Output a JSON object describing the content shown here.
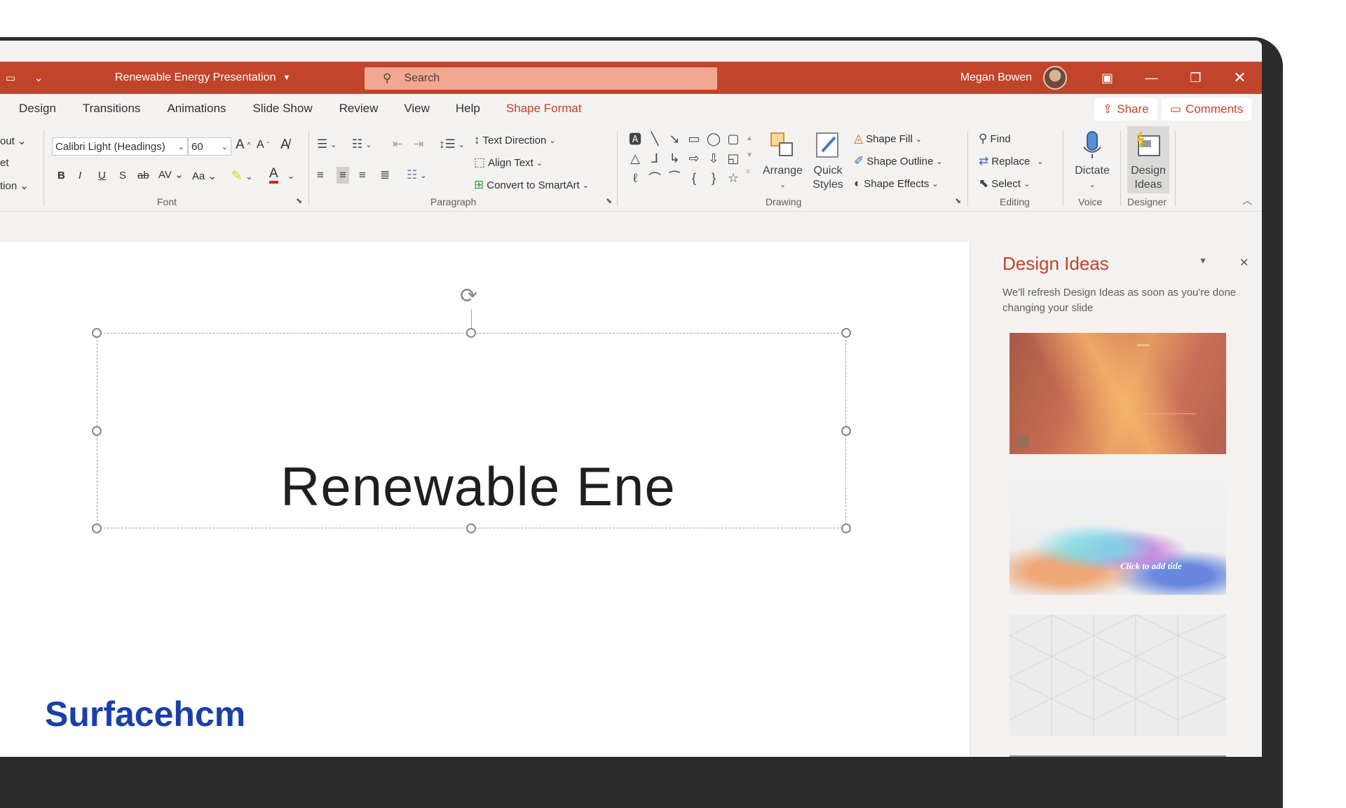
{
  "app": {
    "document_title": "Renewable Energy Presentation",
    "search_placeholder": "Search",
    "user_name": "Megan Bowen",
    "accent": "#b7472a"
  },
  "menu": {
    "tabs": [
      "Design",
      "Transitions",
      "Animations",
      "Slide Show",
      "Review",
      "View",
      "Help",
      "Shape Format"
    ],
    "active_tab": "Shape Format",
    "share_label": "Share",
    "comments_label": "Comments"
  },
  "ribbon": {
    "partial_labels": [
      "out",
      "et",
      "tion"
    ],
    "font": {
      "name": "Calibri Light (Headings)",
      "size": "60",
      "group_label": "Font"
    },
    "paragraph": {
      "text_direction": "Text Direction",
      "align_text": "Align Text",
      "convert_smartart": "Convert to SmartArt",
      "group_label": "Paragraph"
    },
    "drawing": {
      "arrange": "Arrange",
      "quick_styles": "Quick Styles",
      "shape_fill": "Shape Fill",
      "shape_outline": "Shape Outline",
      "shape_effects": "Shape Effects",
      "group_label": "Drawing"
    },
    "editing": {
      "find": "Find",
      "replace": "Replace",
      "select": "Select",
      "group_label": "Editing"
    },
    "voice": {
      "dictate": "Dictate",
      "group_label": "Voice"
    },
    "designer": {
      "design_ideas": "Design Ideas",
      "group_label": "Designer"
    }
  },
  "slide": {
    "title_text": "Renewable Ene"
  },
  "design_pane": {
    "title": "Design Ideas",
    "message": "We'll refresh Design Ideas as soon as you're done changing your slide",
    "thumb2_text": "Click to add title"
  },
  "watermark": {
    "brand": "Surfacehcm"
  }
}
